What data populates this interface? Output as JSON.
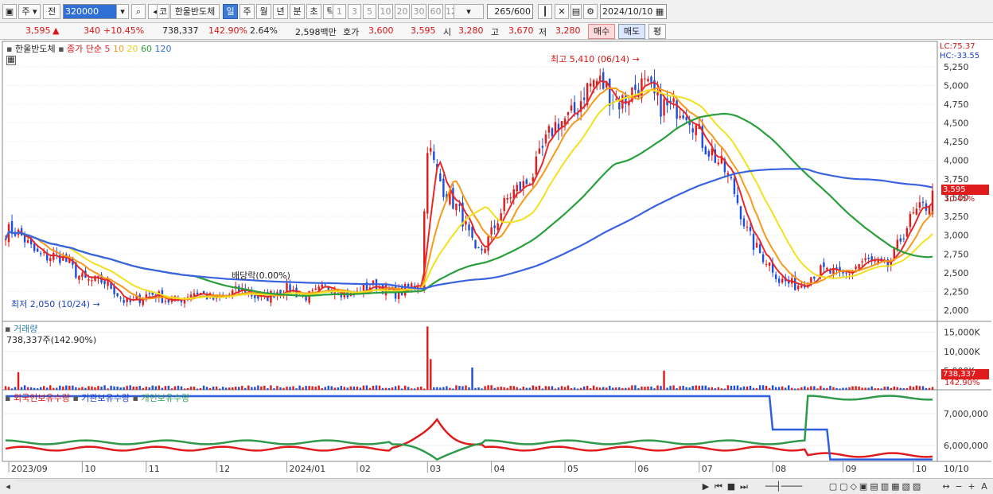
{
  "toolbar": {
    "period_type": "주",
    "prev_label": "전",
    "code_value": "320000",
    "code_label": "코",
    "stock_name": "한울반도체",
    "interval_tabs": [
      "일",
      "주",
      "월",
      "년",
      "분",
      "초",
      "틱"
    ],
    "active_interval": "일",
    "minute_options": [
      "1",
      "3",
      "5",
      "10",
      "20",
      "30",
      "60",
      "120"
    ],
    "count_value": "265",
    "count_total": "/600",
    "date_value": "2024/10/10"
  },
  "quote": {
    "price": "3,595",
    "change_arrow": "▲",
    "change": "340",
    "change_rate": "+10.45%",
    "volume": "738,337",
    "volume_ratio": "142.90%",
    "turnover": "2.64%",
    "amount": "2,598백만",
    "bid_ask_label": "호가",
    "bid": "3,600",
    "ask": "3,595",
    "open_label": "시",
    "open": "3,280",
    "high_label": "고",
    "high": "3,670",
    "low_label": "저",
    "low": "3,280",
    "buy_label": "매수",
    "sell_label": "매도",
    "eval_label": "평"
  },
  "chart_labels": {
    "price_title": "한울반도체",
    "ma_title": "종가 단순",
    "ma_periods": [
      "5",
      "10",
      "20",
      "60",
      "120"
    ],
    "lc": "LC:75.37",
    "hc": "HC:-33.55",
    "high_note": "최고 5,410 (06/14)",
    "low_note": "최저 2,050 (10/24)",
    "dividend_note": "배당락(0.00%)",
    "current_price_tag": "3,595",
    "current_rate_tag": "10.45%",
    "volume_title": "거래량",
    "volume_sub": "738,337주(142.90%)",
    "volume_tag": "738,337",
    "volume_rate_tag": "142.90%",
    "holdings_series": [
      "외국인보유수량",
      "기관보유수량",
      "개인보유수량"
    ],
    "x_ticks": [
      "2023/09",
      "10",
      "11",
      "12",
      "2024/01",
      "02",
      "03",
      "04",
      "05",
      "06",
      "07",
      "08",
      "09",
      "10"
    ],
    "x_end_label": "10/10"
  },
  "chart_data": [
    {
      "type": "line",
      "title": "한울반도체",
      "series": [
        {
          "name": "5",
          "color": "#e8292a"
        },
        {
          "name": "10",
          "color": "#f59a1b"
        },
        {
          "name": "20",
          "color": "#f2e11e"
        },
        {
          "name": "60",
          "color": "#29a03c"
        },
        {
          "name": "120",
          "color": "#3a63e0"
        }
      ],
      "yticks": [
        2000,
        2250,
        2500,
        2750,
        3000,
        3250,
        3500,
        3750,
        4000,
        4250,
        4500,
        4750,
        5000,
        5250
      ],
      "ylim": [
        1850,
        5450
      ],
      "key_points": [
        {
          "x": "2023-08-31",
          "close": 3050,
          "ma120": 4070,
          "ma60": 2950
        },
        {
          "x": "2023-10-24",
          "close": 2150,
          "ma120": 3150
        },
        {
          "x": "2024-02-29",
          "close": 2300,
          "ma120": 2330,
          "ma60": 2300
        },
        {
          "x": "2024-03-04",
          "close": 4200
        },
        {
          "x": "2024-03-25",
          "close": 2750
        },
        {
          "x": "2024-05-10",
          "close": 4950
        },
        {
          "x": "2024-06-14",
          "close": 4850,
          "high": 5410
        },
        {
          "x": "2024-07-05",
          "close": 4200,
          "ma120": 3600
        },
        {
          "x": "2024-07-22",
          "close": 3100
        },
        {
          "x": "2024-08-05",
          "close": 2350
        },
        {
          "x": "2024-09-20",
          "close": 2650
        },
        {
          "x": "2024-10-10",
          "close": 3595,
          "open": 3280,
          "high": 3670,
          "low": 3280,
          "ma120": 3620,
          "ma60": 3050
        }
      ]
    },
    {
      "type": "bar",
      "title": "거래량",
      "yticks": [
        5000,
        10000,
        15000
      ],
      "unit": "K",
      "ylim": [
        0,
        17000
      ],
      "spikes": [
        {
          "x": "2023-09-06",
          "value": 4600
        },
        {
          "x": "2024-03-04",
          "value": 16500
        },
        {
          "x": "2024-03-05",
          "value": 8000
        },
        {
          "x": "2024-03-22",
          "value": 5800
        },
        {
          "x": "2024-06-14",
          "value": 5000
        },
        {
          "x": "2024-10-10",
          "value": 738
        }
      ]
    },
    {
      "type": "line",
      "title": "보유수량",
      "series": [
        {
          "name": "외국인보유수량",
          "color": "#e01b1b"
        },
        {
          "name": "기관보유수량",
          "color": "#2f5fe0"
        },
        {
          "name": "개인보유수량",
          "color": "#2f9a4a"
        }
      ],
      "yticks": [
        6000000,
        7000000
      ],
      "ylim": [
        5500000,
        7600000
      ]
    }
  ]
}
